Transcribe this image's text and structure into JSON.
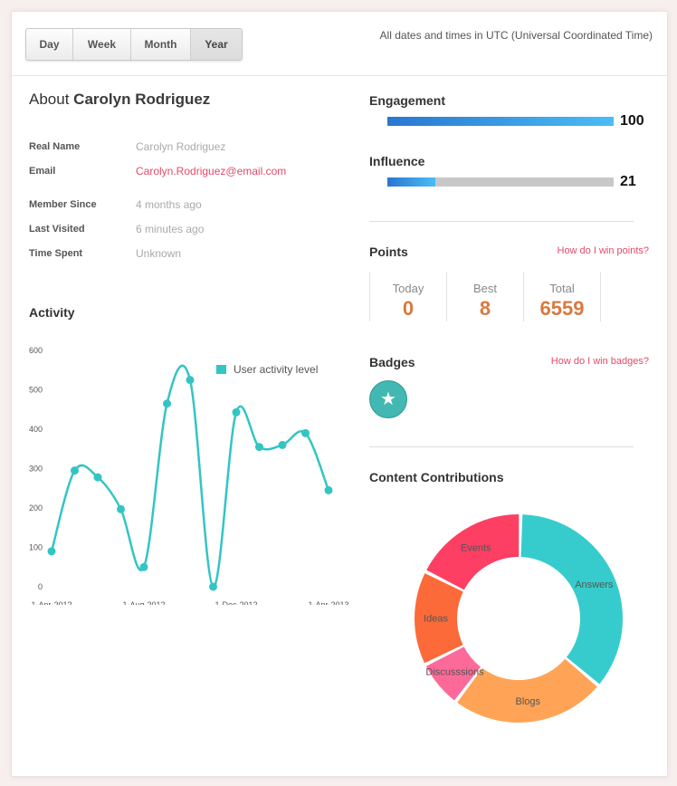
{
  "toolbar": {
    "ranges": [
      "Day",
      "Week",
      "Month",
      "Year"
    ],
    "active_range": "Year",
    "timezone_note": "All dates and times in UTC (Universal Coordinated Time)"
  },
  "about": {
    "prefix": "About",
    "name": "Carolyn Rodriguez",
    "fields": [
      {
        "label": "Real Name",
        "value": "Carolyn Rodriguez"
      },
      {
        "label": "Email",
        "value": "Carolyn.Rodriguez@email.com"
      },
      {
        "label": "Member Since",
        "value": "4 months ago"
      },
      {
        "label": "Last Visited",
        "value": "6 minutes ago"
      },
      {
        "label": "Time Spent",
        "value": "Unknown"
      }
    ]
  },
  "engagement": {
    "title": "Engagement",
    "value": 100,
    "max": 100
  },
  "influence": {
    "title": "Influence",
    "value": 21,
    "max": 100
  },
  "points": {
    "title": "Points",
    "help_link": "How do I win points?",
    "items": [
      {
        "label": "Today",
        "value": "0"
      },
      {
        "label": "Best",
        "value": "8"
      },
      {
        "label": "Total",
        "value": "6559"
      }
    ]
  },
  "badges": {
    "title": "Badges",
    "help_link": "How do I win badges?",
    "items": [
      "star-icon"
    ]
  },
  "activity": {
    "title": "Activity"
  },
  "contributions": {
    "title": "Content Contributions"
  },
  "colors": {
    "accent_link": "#e34a6a",
    "line": "#33c5c3",
    "points_value": "#d9793f"
  },
  "chart_data": [
    {
      "type": "line",
      "legend": "User activity level",
      "x": [
        "1-Apr-2012",
        "1-May-2012",
        "1-Jun-2012",
        "1-Jul-2012",
        "1-Aug-2012",
        "1-Sep-2012",
        "1-Oct-2012",
        "1-Nov-2012",
        "1-Dec-2012",
        "1-Jan-2013",
        "1-Feb-2013",
        "1-Mar-2013",
        "1-Apr-2013"
      ],
      "xticks": [
        "1-Apr-2012",
        "1-Aug-2012",
        "1-Dec-2012",
        "1-Apr-2013"
      ],
      "values": [
        90,
        295,
        278,
        197,
        50,
        465,
        525,
        0,
        443,
        355,
        360,
        390,
        245
      ],
      "ylim": [
        0,
        600
      ],
      "yticks": [
        0,
        100,
        200,
        300,
        400,
        500,
        600
      ]
    },
    {
      "type": "pie",
      "donut": true,
      "slices": [
        {
          "label": "Answers",
          "value": 34,
          "color": "#36cccd"
        },
        {
          "label": "Blogs",
          "value": 23,
          "color": "#ffa456"
        },
        {
          "label": "Discusssions",
          "value": 7,
          "color": "#fc6a9a"
        },
        {
          "label": "Ideas",
          "value": 14,
          "color": "#fc6a39"
        },
        {
          "label": "Events",
          "value": 17,
          "color": "#fd3f64"
        }
      ]
    }
  ]
}
